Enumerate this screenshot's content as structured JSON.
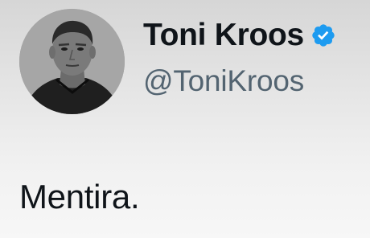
{
  "tweet": {
    "author": {
      "display_name": "Toni Kroos",
      "handle": "@ToniKroos",
      "verified_icon": "verified-badge-icon",
      "avatar_icon": "profile-photo"
    },
    "text": "Mentira."
  },
  "colors": {
    "verified_badge": "#1d9bf0",
    "name_text": "#0f1419",
    "handle_text": "#536471"
  }
}
